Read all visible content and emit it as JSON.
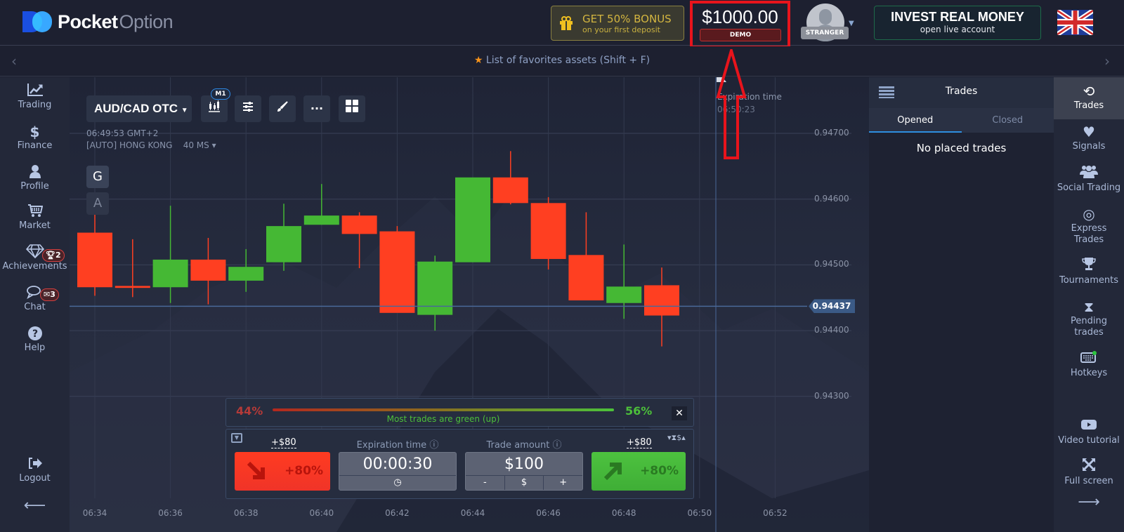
{
  "header": {
    "logo": {
      "word1": "Pocket",
      "word2": "Option"
    },
    "bonus": {
      "title": "GET 50% BONUS",
      "subtitle": "on your first deposit"
    },
    "balance": "$1000.00",
    "account_type": "DEMO",
    "user_label": "STRANGER",
    "invest": {
      "title": "INVEST REAL MONEY",
      "subtitle": "open live account"
    },
    "language": "English (UK flag)"
  },
  "favorites_bar": {
    "text": "List of favorites assets (Shift + F)"
  },
  "left_nav": {
    "items": [
      {
        "label": "Trading",
        "icon": "chart-line-icon"
      },
      {
        "label": "Finance",
        "icon": "dollar-icon"
      },
      {
        "label": "Profile",
        "icon": "user-icon"
      },
      {
        "label": "Market",
        "icon": "cart-icon"
      },
      {
        "label": "Achievements",
        "icon": "diamond-icon",
        "badge": "2"
      },
      {
        "label": "Chat",
        "icon": "chat-icon",
        "badge": "3"
      },
      {
        "label": "Help",
        "icon": "help-icon"
      }
    ],
    "logout": "Logout"
  },
  "chart_toolbar": {
    "asset": "AUD/CAD OTC",
    "timeframe": "M1",
    "server_time": "06:49:53 GMT+2",
    "server": "[AUTO] HONG KONG",
    "ping": "40 MS",
    "btn_g": "G",
    "btn_a": "A"
  },
  "expiration_marker": {
    "label": "Expiration time",
    "time": "06:50:23"
  },
  "chart_data": {
    "type": "candlestick",
    "title": "AUD/CAD OTC",
    "timeframe": "M1",
    "x_ticks": [
      "06:34",
      "06:36",
      "06:38",
      "06:40",
      "06:42",
      "06:44",
      "06:46",
      "06:48",
      "06:50",
      "06:52"
    ],
    "y_ticks": [
      "0.94700",
      "0.94600",
      "0.94500",
      "0.94400",
      "0.94300"
    ],
    "ylim": [
      0.9424,
      0.9479
    ],
    "current_price": "0.94437",
    "candles": [
      {
        "t": "06:34",
        "o": 0.94549,
        "h": 0.94577,
        "l": 0.94453,
        "c": 0.94466
      },
      {
        "t": "06:35",
        "o": 0.94468,
        "h": 0.94539,
        "l": 0.94451,
        "c": 0.94465
      },
      {
        "t": "06:36",
        "o": 0.94466,
        "h": 0.9459,
        "l": 0.94442,
        "c": 0.94508
      },
      {
        "t": "06:37",
        "o": 0.94508,
        "h": 0.94541,
        "l": 0.9444,
        "c": 0.94476
      },
      {
        "t": "06:38",
        "o": 0.94476,
        "h": 0.94524,
        "l": 0.94459,
        "c": 0.94497
      },
      {
        "t": "06:39",
        "o": 0.94504,
        "h": 0.94593,
        "l": 0.94491,
        "c": 0.94559
      },
      {
        "t": "06:40",
        "o": 0.94561,
        "h": 0.94623,
        "l": 0.94561,
        "c": 0.94575
      },
      {
        "t": "06:41",
        "o": 0.94575,
        "h": 0.9458,
        "l": 0.94495,
        "c": 0.94547
      },
      {
        "t": "06:42",
        "o": 0.94551,
        "h": 0.94559,
        "l": 0.94428,
        "c": 0.94427
      },
      {
        "t": "06:43",
        "o": 0.94424,
        "h": 0.94514,
        "l": 0.944,
        "c": 0.94505
      },
      {
        "t": "06:44",
        "o": 0.94504,
        "h": 0.94632,
        "l": 0.94504,
        "c": 0.94633
      },
      {
        "t": "06:45",
        "o": 0.94633,
        "h": 0.94673,
        "l": 0.94592,
        "c": 0.94594
      },
      {
        "t": "06:46",
        "o": 0.94594,
        "h": 0.94603,
        "l": 0.94493,
        "c": 0.94509
      },
      {
        "t": "06:47",
        "o": 0.94515,
        "h": 0.9458,
        "l": 0.94446,
        "c": 0.94446
      },
      {
        "t": "06:48",
        "o": 0.94442,
        "h": 0.94531,
        "l": 0.94418,
        "c": 0.94467
      },
      {
        "t": "06:49",
        "o": 0.94469,
        "h": 0.94496,
        "l": 0.94376,
        "c": 0.94423
      }
    ],
    "colors": {
      "up": "#45b834",
      "down": "#ff3f21"
    }
  },
  "sentiment": {
    "down_pct": "44%",
    "up_pct": "56%",
    "up_fraction": 0.56,
    "text": "Most trades are green (up)"
  },
  "trade_panel": {
    "put_payout": "+$80",
    "call_payout": "+$80",
    "put_pct": "+80%",
    "call_pct": "+80%",
    "expiration_label": "Expiration time",
    "expiration_value": "00:00:30",
    "amount_label": "Trade amount",
    "amount_value": "$100",
    "amount_minus": "-",
    "amount_currency": "$",
    "amount_plus": "+"
  },
  "trades_panel": {
    "title": "Trades",
    "tabs": [
      "Opened",
      "Closed"
    ],
    "active_tab": "Opened",
    "empty_text": "No placed trades"
  },
  "right_nav": {
    "items": [
      {
        "label": "Trades",
        "icon": "history-icon",
        "active": true
      },
      {
        "label": "Signals",
        "icon": "heartbeat-icon"
      },
      {
        "label": "Social Trading",
        "icon": "users-icon"
      },
      {
        "label": "Express Trades",
        "icon": "target-icon"
      },
      {
        "label": "Tournaments",
        "icon": "trophy-icon"
      },
      {
        "label": "Pending trades",
        "icon": "hourglass-icon"
      },
      {
        "label": "Hotkeys",
        "icon": "keyboard-icon"
      },
      {
        "label": "Video tutorial",
        "icon": "youtube-icon"
      },
      {
        "label": "Full screen",
        "icon": "fullscreen-icon"
      }
    ]
  }
}
